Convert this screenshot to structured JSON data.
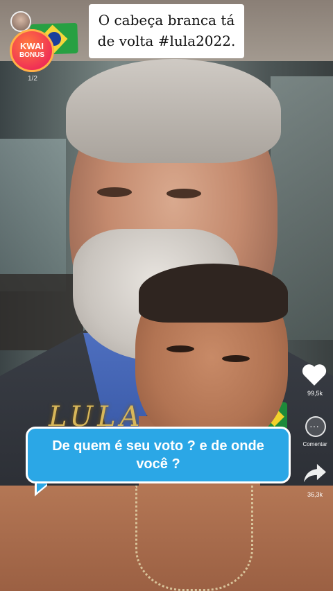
{
  "header": {
    "caption_line1": "O cabeça branca tá",
    "caption_line2": "de volta #lula2022."
  },
  "badge": {
    "brand": "KWAI",
    "label": "BONUS",
    "counter": "1/2"
  },
  "overlay": {
    "gold_text": "LULA"
  },
  "question": {
    "line1": "De quem é seu voto ? e de onde",
    "line2": "você ?"
  },
  "actions": {
    "likes": "99,5k",
    "comment_label": "Comentar",
    "shares": "36,3k"
  },
  "colors": {
    "bubble": "#2ba7e6",
    "badge": "#ef2b57",
    "caption_bg": "#ffffff"
  },
  "icons": [
    "heart-icon",
    "comment-icon",
    "share-icon",
    "brazil-flag-icon"
  ]
}
